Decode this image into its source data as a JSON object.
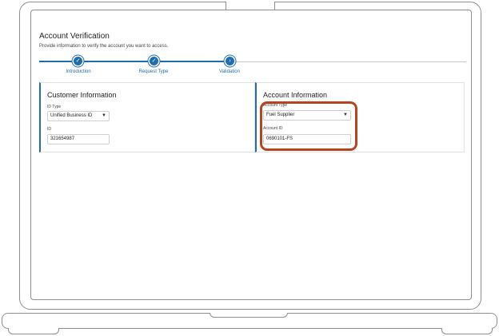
{
  "page": {
    "title": "Account Verification",
    "subtitle": "Provide information to verify the account you want to access."
  },
  "steps": [
    {
      "label": "Introduction",
      "icon": "check-icon",
      "glyph": "✓"
    },
    {
      "label": "Request Type",
      "icon": "check-icon",
      "glyph": "✓"
    },
    {
      "label": "Validation",
      "icon": "chevron-right-icon",
      "glyph": "›"
    }
  ],
  "customer": {
    "heading": "Customer Information",
    "id_type_label": "ID Type",
    "id_type_value": "Unified Business ID",
    "id_label": "ID",
    "id_value": "321654987"
  },
  "account": {
    "heading": "Account Information",
    "type_label": "Account Type",
    "type_value": "Fuel Supplier",
    "id_label": "Account ID",
    "id_value": "0690101-FS"
  },
  "colors": {
    "accent": "#1f6db0",
    "highlight": "#b5441f"
  }
}
